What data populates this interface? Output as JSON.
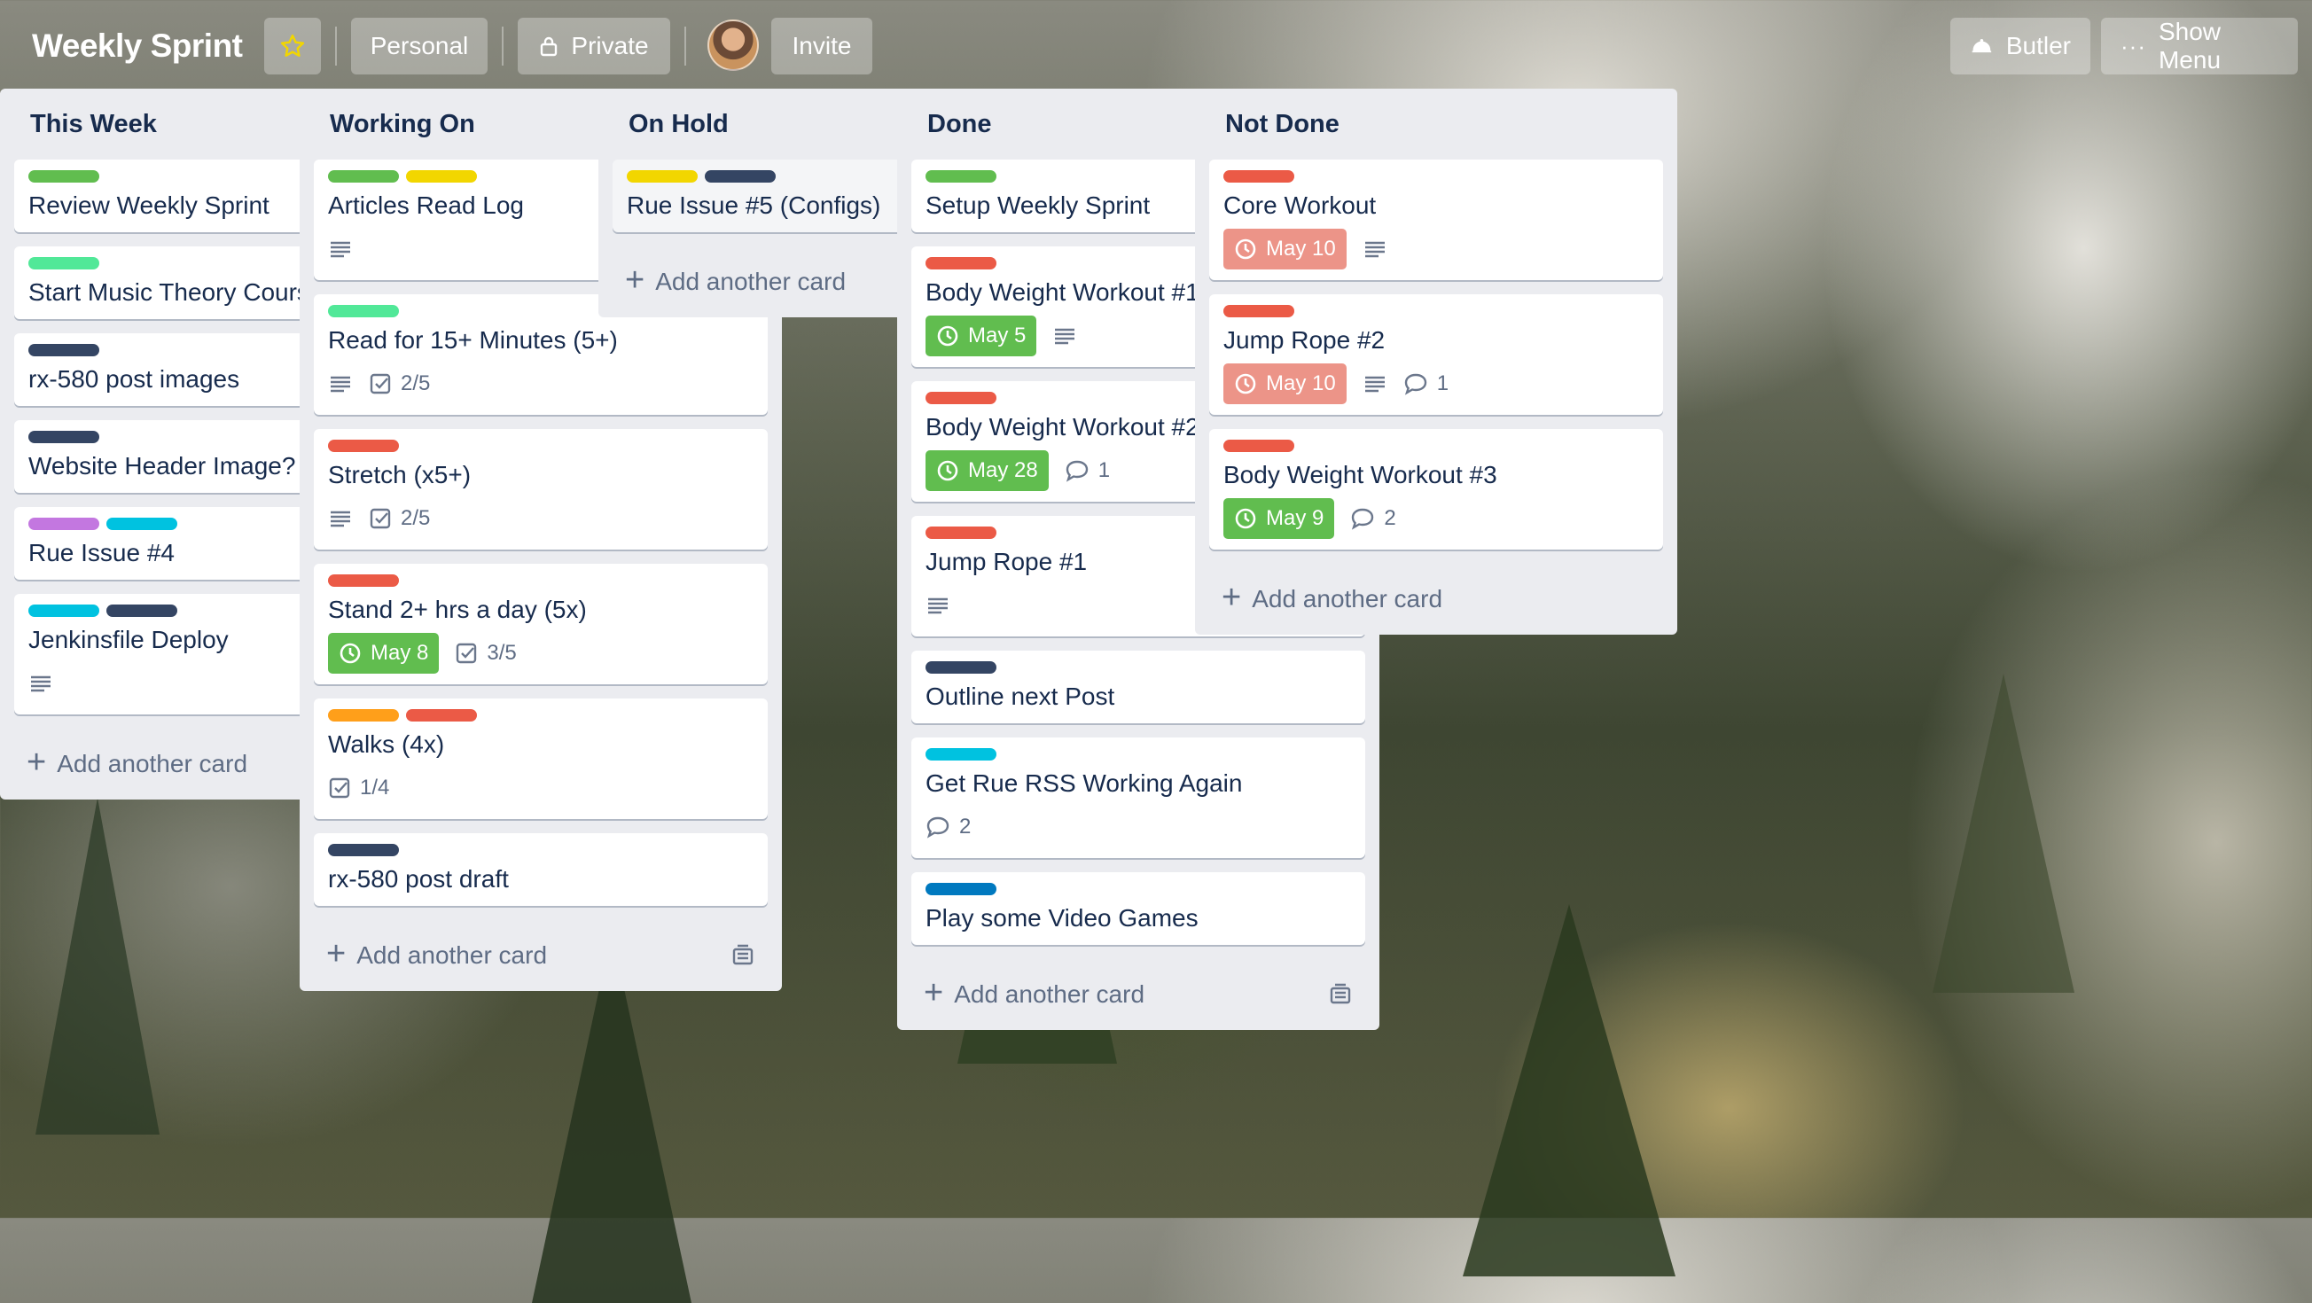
{
  "board": {
    "title": "Weekly Sprint"
  },
  "header": {
    "personal": "Personal",
    "private": "Private",
    "invite": "Invite",
    "butler": "Butler",
    "show_menu": "Show Menu"
  },
  "colors": {
    "green": "#61bd4f",
    "lime": "#51e898",
    "yellow": "#f2d600",
    "orange": "#ff9f1a",
    "red": "#eb5a46",
    "purple": "#c377e0",
    "sky": "#00c2e0",
    "blue": "#0079bf",
    "black": "#344563"
  },
  "lists": [
    {
      "title": "This Week",
      "add_label": "Add another card",
      "cards": [
        {
          "title": "Review Weekly Sprint",
          "labels": [
            "green"
          ]
        },
        {
          "title": "Start Music Theory Course",
          "labels": [
            "lime"
          ]
        },
        {
          "title": "rx-580 post images",
          "labels": [
            "black"
          ]
        },
        {
          "title": "Website Header Image?",
          "labels": [
            "black"
          ]
        },
        {
          "title": "Rue Issue #4",
          "labels": [
            "purple",
            "sky"
          ]
        },
        {
          "title": "Jenkinsfile Deploy",
          "labels": [
            "sky",
            "black"
          ],
          "description": true
        }
      ]
    },
    {
      "title": "Working On",
      "add_label": "Add another card",
      "cards": [
        {
          "title": "Articles Read Log",
          "labels": [
            "green",
            "yellow"
          ],
          "description": true
        },
        {
          "title": "Read for 15+ Minutes (5+)",
          "labels": [
            "lime"
          ],
          "description": true,
          "checklist": "2/5"
        },
        {
          "title": "Stretch (x5+)",
          "labels": [
            "red"
          ],
          "description": true,
          "checklist": "2/5"
        },
        {
          "title": "Stand 2+ hrs a day (5x)",
          "labels": [
            "red"
          ],
          "due": "May 8",
          "due_status": "green",
          "checklist": "3/5"
        },
        {
          "title": "Walks (4x)",
          "labels": [
            "orange",
            "red"
          ],
          "checklist": "1/4"
        },
        {
          "title": "rx-580 post draft",
          "labels": [
            "black"
          ]
        }
      ]
    },
    {
      "title": "On Hold",
      "add_label": "Add another card",
      "cards": [
        {
          "title": "Rue Issue #5 (Configs)",
          "labels": [
            "yellow",
            "black"
          ],
          "hover": true
        }
      ]
    },
    {
      "title": "Done",
      "add_label": "Add another card",
      "cards": [
        {
          "title": "Setup Weekly Sprint",
          "labels": [
            "green"
          ]
        },
        {
          "title": "Body Weight Workout #1",
          "labels": [
            "red"
          ],
          "due": "May 5",
          "due_status": "green",
          "description": true
        },
        {
          "title": "Body Weight Workout #2",
          "labels": [
            "red"
          ],
          "due": "May 28",
          "due_status": "green",
          "comments": "1"
        },
        {
          "title": "Jump Rope #1",
          "labels": [
            "red"
          ],
          "description": true
        },
        {
          "title": "Outline next Post",
          "labels": [
            "black"
          ]
        },
        {
          "title": "Get Rue RSS Working Again",
          "labels": [
            "sky"
          ],
          "comments": "2"
        },
        {
          "title": "Play some Video Games",
          "labels": [
            "blue"
          ]
        }
      ]
    },
    {
      "title": "Not Done",
      "add_label": "Add another card",
      "cards": [
        {
          "title": "Core Workout",
          "labels": [
            "red"
          ],
          "due": "May 10",
          "due_status": "red",
          "description": true
        },
        {
          "title": "Jump Rope #2",
          "labels": [
            "red"
          ],
          "due": "May 10",
          "due_status": "red",
          "description": true,
          "comments": "1"
        },
        {
          "title": "Body Weight Workout #3",
          "labels": [
            "red"
          ],
          "due": "May 9",
          "due_status": "green",
          "comments": "2"
        }
      ]
    }
  ],
  "icons": {
    "star": "star-icon",
    "lock": "lock-icon",
    "butler": "butler-icon",
    "more": "more-icon",
    "description": "description-icon",
    "checklist": "checklist-icon",
    "comment": "comment-icon",
    "clock": "clock-icon",
    "template": "card-template-icon",
    "pencil": "pencil-icon"
  }
}
